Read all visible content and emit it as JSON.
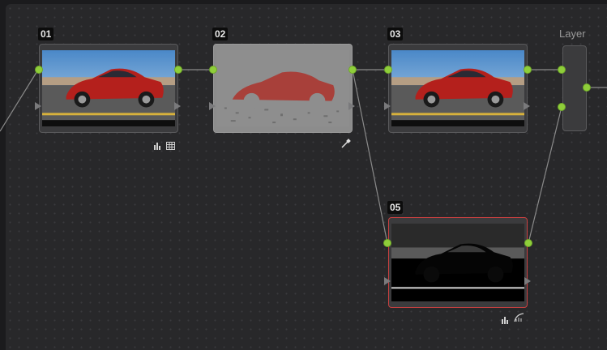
{
  "nodes": [
    {
      "id": "01",
      "label": "01"
    },
    {
      "id": "02",
      "label": "02"
    },
    {
      "id": "03",
      "label": "03"
    },
    {
      "id": "05",
      "label": "05"
    }
  ],
  "layer_mixer": {
    "label": "Layer"
  },
  "colors": {
    "connection_port": "#8fce3a",
    "selected_outline": "#c84040",
    "wire": "#8a8a8a"
  },
  "icons": {
    "node01": [
      "histogram-icon",
      "grid-icon"
    ],
    "node02": [
      "eyedropper-icon"
    ],
    "node05": [
      "histogram-icon",
      "curves-icon"
    ]
  }
}
